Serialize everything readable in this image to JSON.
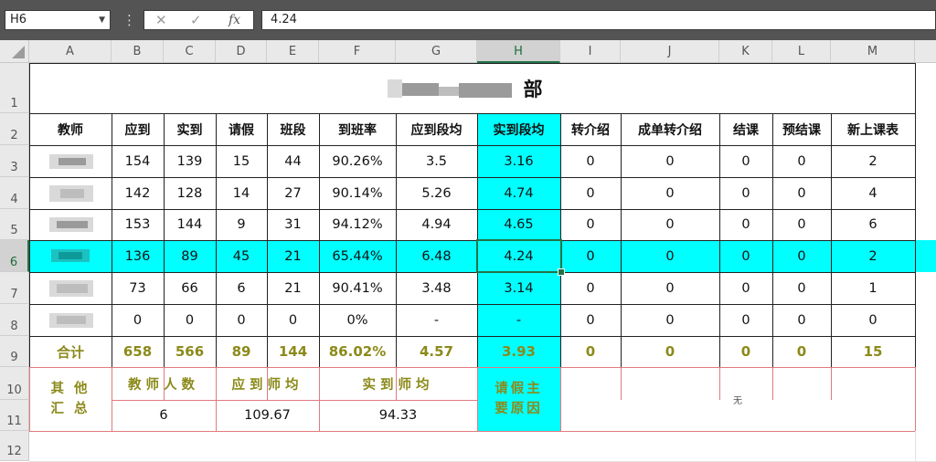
{
  "formula_bar": {
    "name_box": "H6",
    "cancel_icon": "✕",
    "enter_icon": "✓",
    "fx_label": "fx",
    "formula": "4.24"
  },
  "columns": [
    "A",
    "B",
    "C",
    "D",
    "E",
    "F",
    "G",
    "H",
    "I",
    "J",
    "K",
    "L",
    "M"
  ],
  "selected_column": "H",
  "rows": [
    "1",
    "2",
    "3",
    "4",
    "5",
    "6",
    "7",
    "8",
    "9",
    "10",
    "11",
    "12"
  ],
  "selected_row": "6",
  "sheet": {
    "title": "部",
    "headers": [
      "教师",
      "应到",
      "实到",
      "请假",
      "班段",
      "到班率",
      "应到段均",
      "实到段均",
      "转介绍",
      "成单转介绍",
      "结课",
      "预结课",
      "新上课表"
    ],
    "data_rows": [
      [
        "",
        "154",
        "139",
        "15",
        "44",
        "90.26%",
        "3.5",
        "3.16",
        "0",
        "0",
        "0",
        "0",
        "2"
      ],
      [
        "",
        "142",
        "128",
        "14",
        "27",
        "90.14%",
        "5.26",
        "4.74",
        "0",
        "0",
        "0",
        "0",
        "4"
      ],
      [
        "",
        "153",
        "144",
        "9",
        "31",
        "94.12%",
        "4.94",
        "4.65",
        "0",
        "0",
        "0",
        "0",
        "6"
      ],
      [
        "",
        "136",
        "89",
        "45",
        "21",
        "65.44%",
        "6.48",
        "4.24",
        "0",
        "0",
        "0",
        "0",
        "2"
      ],
      [
        "",
        "73",
        "66",
        "6",
        "21",
        "90.41%",
        "3.48",
        "3.14",
        "0",
        "0",
        "0",
        "0",
        "1"
      ],
      [
        "",
        "0",
        "0",
        "0",
        "0",
        "0%",
        "-",
        "-",
        "0",
        "0",
        "0",
        "0",
        "0"
      ]
    ],
    "total_row": [
      "合计",
      "658",
      "566",
      "89",
      "144",
      "86.02%",
      "4.57",
      "3.93",
      "0",
      "0",
      "0",
      "0",
      "15"
    ],
    "summary": {
      "label": "其他汇总",
      "label_line1": "其 他",
      "label_line2": "汇 总",
      "teacher_count_label": "教师人数",
      "teacher_count": "6",
      "avg_expected_label": "应到师均",
      "avg_expected": "109.67",
      "avg_actual_label": "实到师均",
      "avg_actual": "94.33",
      "leave_reason_label_line1": "请假主",
      "leave_reason_label_line2": "要原因",
      "leave_reason": "无"
    }
  },
  "colors": {
    "highlight": "#00ffff",
    "accent": "#217346",
    "total_text": "#8b8a1a",
    "summary_border": "#e07a80"
  }
}
